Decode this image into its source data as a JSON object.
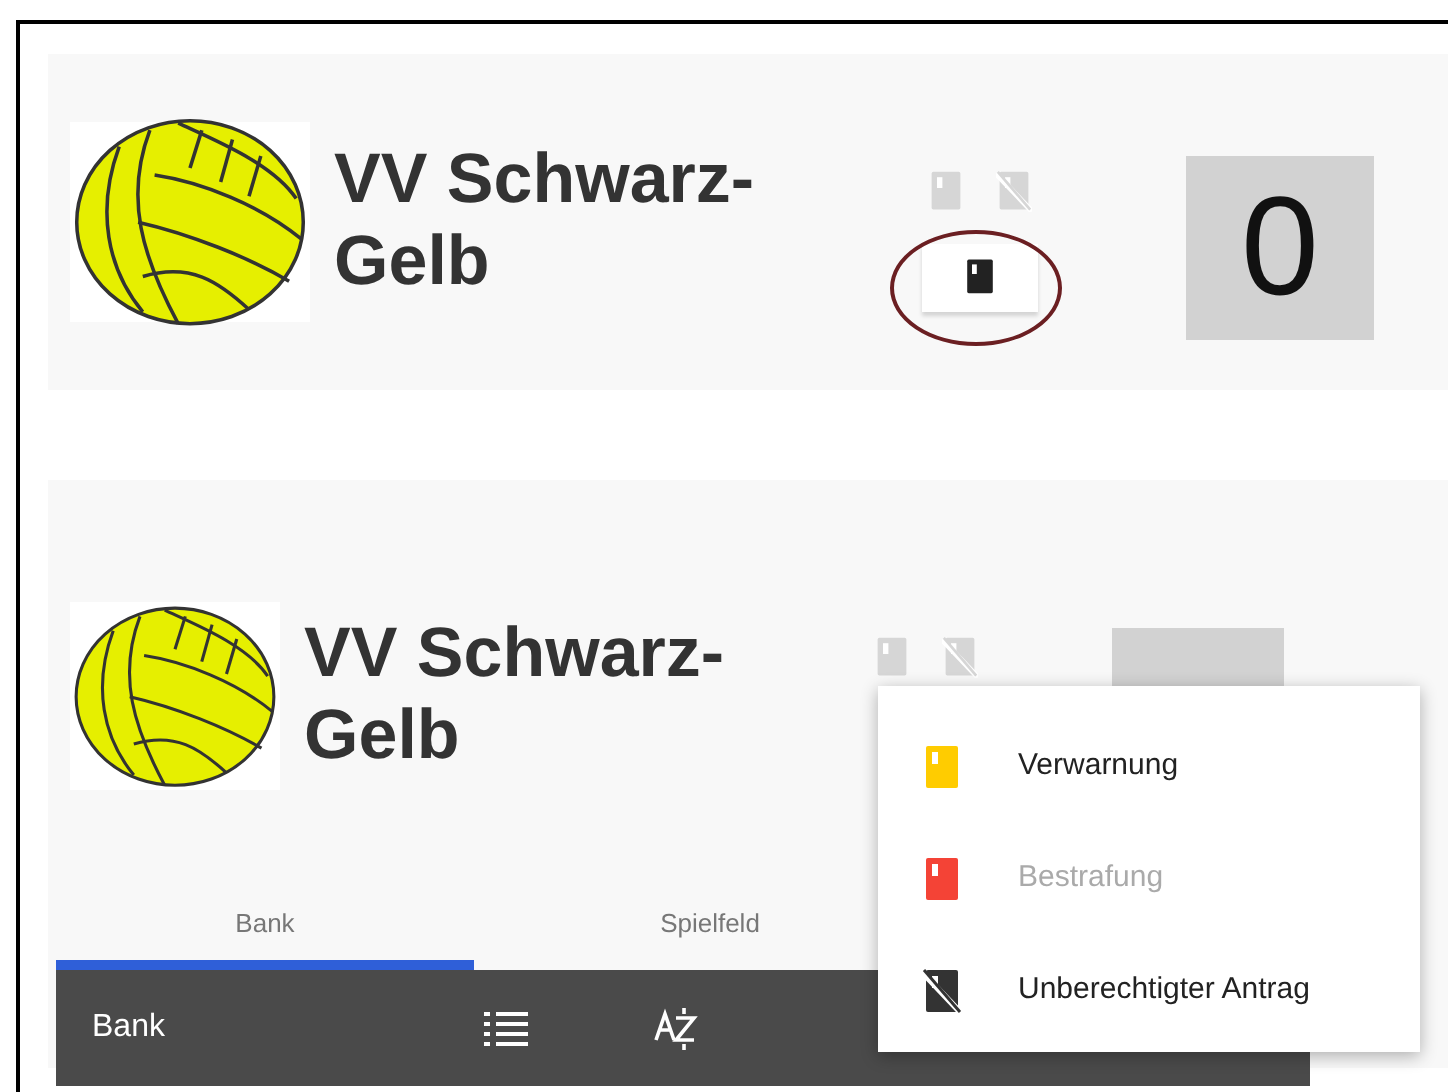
{
  "panels": [
    {
      "team": "VV Schwarz-Gelb",
      "score": "0",
      "highlighted": true
    },
    {
      "team": "VV Schwarz-Gelb",
      "highlighted": false
    }
  ],
  "tabs": [
    {
      "label": "Bank",
      "selected": true
    },
    {
      "label": "Spielfeld",
      "selected": false
    }
  ],
  "toolbar": {
    "title": "Bank"
  },
  "menu": [
    {
      "label": "Verwarnung",
      "kind": "card",
      "color": "#ffcc00",
      "disabled": false
    },
    {
      "label": "Bestrafung",
      "kind": "card",
      "color": "#f44336",
      "disabled": true
    },
    {
      "label": "Unberechtigter Antrag",
      "kind": "void",
      "disabled": false
    }
  ]
}
